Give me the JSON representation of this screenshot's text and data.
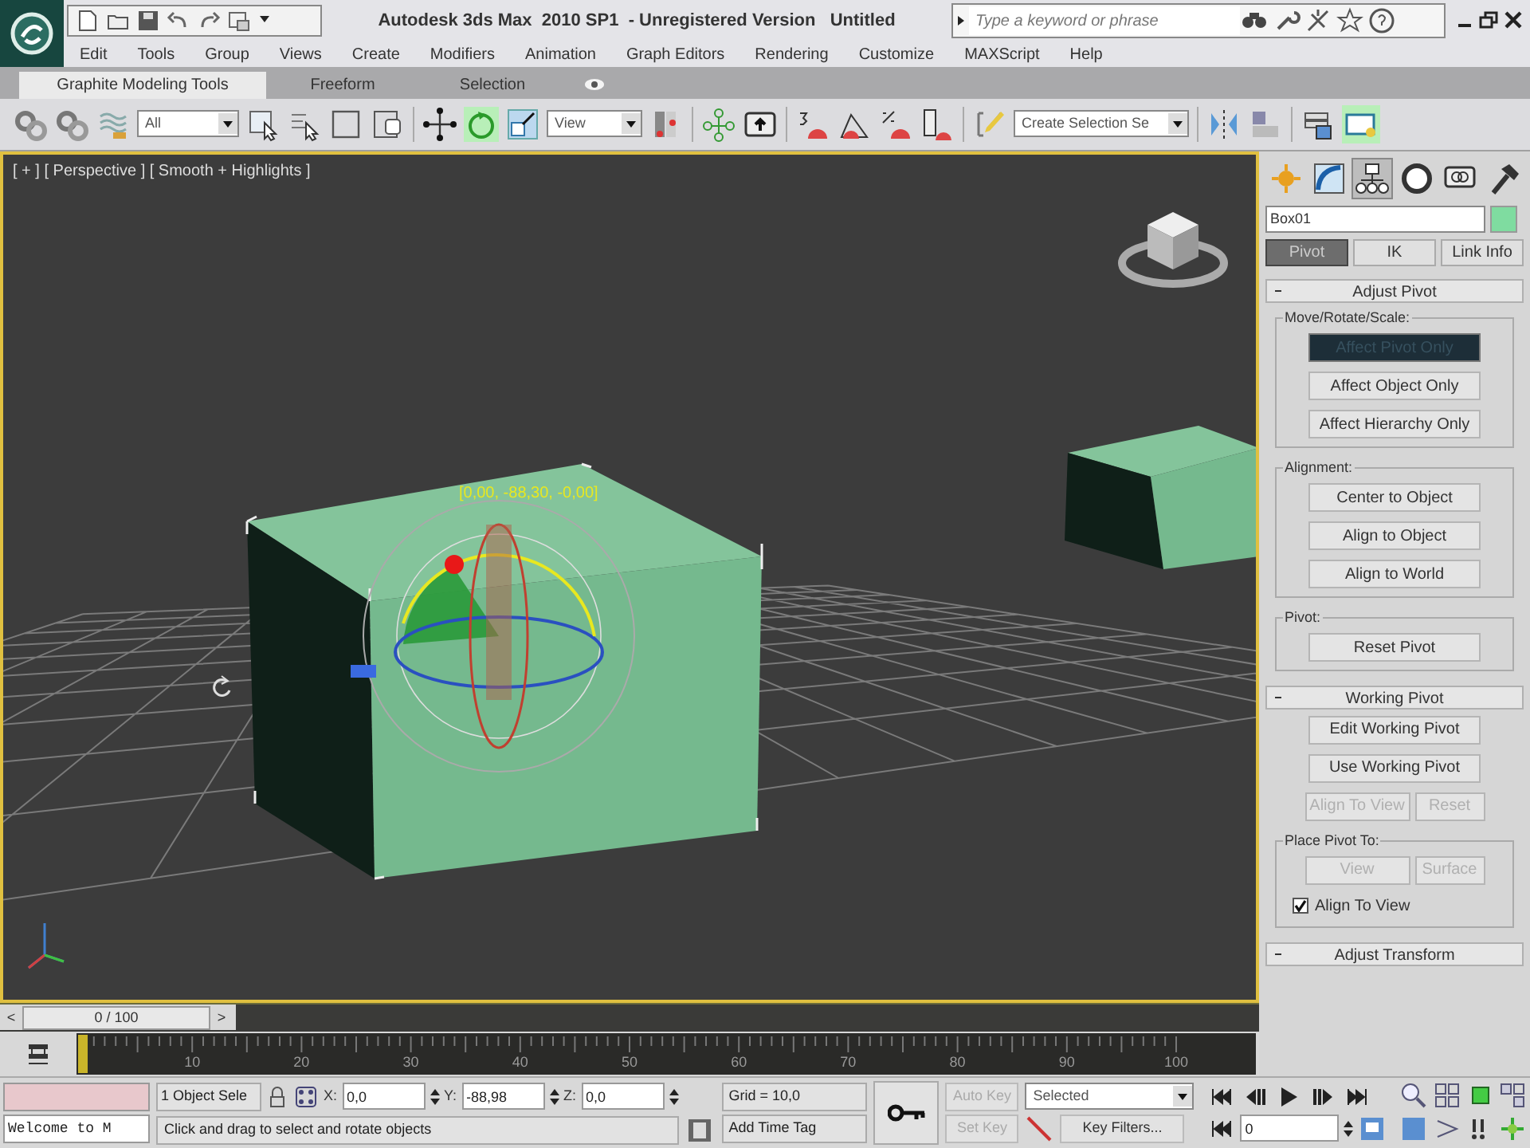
{
  "title_bar": {
    "title": "Autodesk 3ds Max  2010 SP1  - Unregistered Version   Untitled",
    "search": {
      "placeholder": "Type a keyword or phrase"
    }
  },
  "menu": [
    "Edit",
    "Tools",
    "Group",
    "Views",
    "Create",
    "Modifiers",
    "Animation",
    "Graph Editors",
    "Rendering",
    "Customize",
    "MAXScript",
    "Help"
  ],
  "ribbon_tabs": [
    {
      "label": "Graphite Modeling Tools",
      "selected": true
    },
    {
      "label": "Freeform",
      "selected": false
    },
    {
      "label": "Selection",
      "selected": false
    }
  ],
  "main_toolbar": {
    "selection_filter": "All",
    "reference_coordinate": "View",
    "named_selection": "Create Selection Se"
  },
  "viewport": {
    "label": "[ + ] [ Perspective ] [ Smooth + Highlights ]",
    "gizmo_readout": "[0,00, -88,30, -0,00]"
  },
  "command_panel": {
    "object_name": "Box01",
    "subtabs": [
      {
        "label": "Pivot",
        "selected": true
      },
      {
        "label": "IK",
        "selected": false
      },
      {
        "label": "Link Info",
        "selected": false
      }
    ],
    "rollouts": [
      {
        "title": "Adjust Pivot",
        "items": [
          {
            "kind": "group",
            "title": "Move/Rotate/Scale:",
            "items": [
              {
                "kind": "button",
                "label": "Affect Pivot Only",
                "pressed": true,
                "disabled": false
              },
              {
                "kind": "button",
                "label": "Affect Object Only",
                "pressed": false,
                "disabled": false
              },
              {
                "kind": "button",
                "label": "Affect Hierarchy Only",
                "pressed": false,
                "disabled": false
              }
            ]
          },
          {
            "kind": "group",
            "title": "Alignment:",
            "items": [
              {
                "kind": "button",
                "label": "Center to Object",
                "pressed": false,
                "disabled": false
              },
              {
                "kind": "button",
                "label": "Align to Object",
                "pressed": false,
                "disabled": false
              },
              {
                "kind": "button",
                "label": "Align to World",
                "pressed": false,
                "disabled": false
              }
            ]
          },
          {
            "kind": "group",
            "title": "Pivot:",
            "items": [
              {
                "kind": "button",
                "label": "Reset Pivot",
                "pressed": false,
                "disabled": false
              }
            ]
          }
        ]
      },
      {
        "title": "Working Pivot",
        "items": [
          {
            "kind": "button",
            "label": "Edit Working Pivot",
            "pressed": false,
            "disabled": false
          },
          {
            "kind": "button",
            "label": "Use Working Pivot",
            "pressed": false,
            "disabled": false
          },
          {
            "kind": "row",
            "items": [
              {
                "kind": "button",
                "label": "Align To View",
                "disabled": true
              },
              {
                "kind": "button",
                "label": "Reset",
                "disabled": true
              }
            ]
          },
          {
            "kind": "group",
            "title": "Place Pivot To:",
            "items": [
              {
                "kind": "row",
                "items": [
                  {
                    "kind": "button",
                    "label": "View",
                    "disabled": true
                  },
                  {
                    "kind": "button",
                    "label": "Surface",
                    "disabled": true
                  }
                ]
              },
              {
                "kind": "checkbox",
                "label": "Align To View",
                "checked": true
              }
            ]
          }
        ]
      },
      {
        "title": "Adjust Transform"
      }
    ]
  },
  "time_slider": {
    "position": "0 / 100",
    "prev": "<",
    "next": ">"
  },
  "track_bar": {
    "ticks": [
      "10",
      "20",
      "30",
      "40",
      "50",
      "60",
      "70",
      "80",
      "90",
      "100"
    ]
  },
  "status": {
    "maxscript_listener": "Welcome to M",
    "selection_count": "1 Object Sele",
    "coords": [
      {
        "label": "X:",
        "value": "0,0"
      },
      {
        "label": "Y:",
        "value": "-88,98"
      },
      {
        "label": "Z:",
        "value": "0,0"
      }
    ],
    "grid": "Grid = 10,0",
    "prompt": "Click and drag to select and rotate objects",
    "time_tag": "Add Time Tag",
    "auto_key": {
      "label": "Auto Key",
      "disabled": true
    },
    "set_key": {
      "label": "Set Key",
      "disabled": true
    },
    "key_mode": "Selected",
    "key_filters": "Key Filters...",
    "current_frame": "0"
  }
}
